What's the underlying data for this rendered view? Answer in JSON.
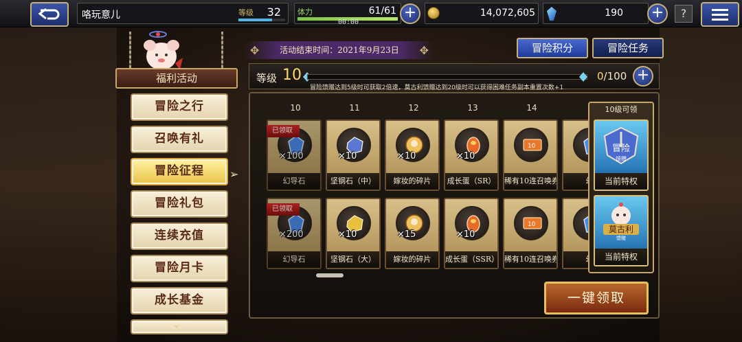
{
  "topbar": {
    "player_name": "咯玩意儿",
    "level_label": "等级",
    "level_value": "32",
    "level_xp_fraction": 0.72,
    "stamina_label": "体力",
    "stamina_value": "61/61",
    "stamina_fraction": 1.0,
    "stamina_timer": "00:00",
    "gil_value": "14,072,605",
    "gems_value": "190",
    "help_icon": "question-mark-icon",
    "back_icon": "return-arrow-icon",
    "menu_icon": "hamburger-menu-icon"
  },
  "sidebar": {
    "title": "福利活动",
    "items": [
      {
        "label": "冒险之行"
      },
      {
        "label": "召唤有礼"
      },
      {
        "label": "冒险征程"
      },
      {
        "label": "冒险礼包"
      },
      {
        "label": "连续充值"
      },
      {
        "label": "冒险月卡"
      },
      {
        "label": "成长基金"
      },
      {
        "label": ""
      }
    ],
    "active_index": 2
  },
  "banner": {
    "text": "活动结束时间：2021年9月23日"
  },
  "tabs": [
    {
      "label": "冒险积分",
      "active": true
    },
    {
      "label": "冒险任务",
      "active": false
    }
  ],
  "level_row": {
    "label": "等级",
    "level": "10",
    "progress_fraction": 0.0,
    "description": "冒险馈赠达到5级时可获取2倍速，莫古利馈赠达到20级时可以获得困难任务副本重置次数+1",
    "points_current": "0",
    "points_total": "/100"
  },
  "rewards": {
    "columns": [
      "10",
      "11",
      "12",
      "13",
      "14",
      ""
    ],
    "claimed_label": "已领取",
    "rows": [
      {
        "cells": [
          {
            "name": "幻导石",
            "qty": "×100",
            "icon": "blue-crystal-icon",
            "claimed": true
          },
          {
            "name": "坚钢石（中）",
            "qty": "×10",
            "icon": "steel-ore-icon",
            "claimed": false
          },
          {
            "name": "嫁妆的碎片",
            "qty": "×10",
            "icon": "shard-icon",
            "claimed": false
          },
          {
            "name": "成长蛋（SR）",
            "qty": "×10",
            "icon": "growth-egg-icon",
            "claimed": false
          },
          {
            "name": "稀有10连召唤券",
            "qty": "",
            "icon": "summon-ticket-icon",
            "claimed": false
          },
          {
            "name": "幻",
            "qty": "",
            "icon": "blue-crystal-icon",
            "claimed": false
          }
        ]
      },
      {
        "cells": [
          {
            "name": "幻导石",
            "qty": "×200",
            "icon": "blue-crystal-icon",
            "claimed": true
          },
          {
            "name": "坚钢石（大）",
            "qty": "×10",
            "icon": "gold-ore-icon",
            "claimed": false
          },
          {
            "name": "嫁妆的碎片",
            "qty": "×15",
            "icon": "shard-icon",
            "claimed": false
          },
          {
            "name": "成长蛋（SSR）",
            "qty": "×10",
            "icon": "growth-egg-icon",
            "claimed": false
          },
          {
            "name": "稀有10连召唤券",
            "qty": "",
            "icon": "summon-ticket-icon",
            "claimed": false
          },
          {
            "name": "幻",
            "qty": "",
            "icon": "blue-crystal-icon",
            "claimed": false
          }
        ]
      }
    ]
  },
  "vip_panel": {
    "header": "10级可领",
    "cards": [
      {
        "title": "冒险",
        "sub": "馈赠",
        "label": "当前特权",
        "icon": "adventure-emblem-icon"
      },
      {
        "title": "莫古利",
        "sub": "馈赠",
        "label": "当前特权",
        "icon": "moogle-emblem-icon"
      }
    ]
  },
  "claim_all_label": "一键领取",
  "colors": {
    "accent_blue": "#3b55a8",
    "gold_border": "#c9b27a",
    "claimed_red": "#d82a2a",
    "stamina_green": "#7cc24a"
  }
}
